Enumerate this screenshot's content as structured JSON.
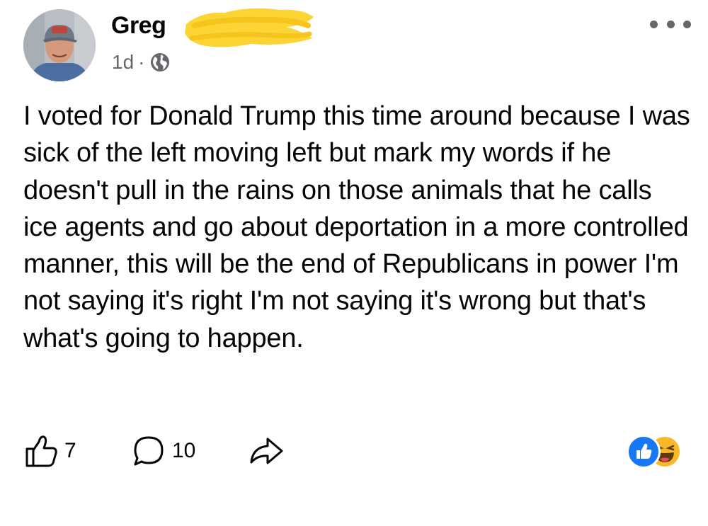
{
  "post": {
    "author": {
      "name": "Greg"
    },
    "timestamp": "1d",
    "separator": "·",
    "privacy_icon": "globe-icon",
    "menu_icon": "more-options-icon",
    "text": "I voted for Donald Trump this time around because I was sick of the left moving left but mark my words if he doesn't pull in the rains on those animals that he calls ice agents and go about deportation in a more controlled manner, this will be the end of Republicans in power I'm not saying it's right I'm not saying it's wrong but that's what's going to happen.",
    "actions": {
      "like_icon": "thumbs-up-icon",
      "like_count": "7",
      "comment_icon": "comment-bubble-icon",
      "comment_count": "10",
      "share_icon": "share-arrow-icon"
    },
    "reactions": [
      "like-reaction-icon",
      "haha-reaction-icon"
    ]
  },
  "colors": {
    "text": "#050505",
    "secondary_text": "#65676b",
    "like_blue": "#1877f2",
    "haha_yellow": "#f7b928",
    "redaction_yellow": "#fcd434"
  }
}
